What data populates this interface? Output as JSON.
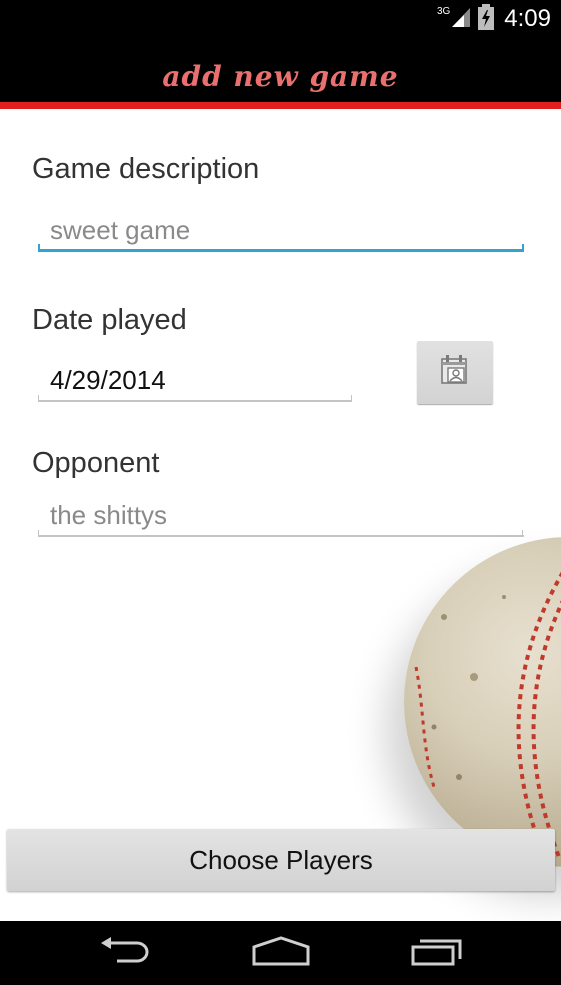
{
  "status_bar": {
    "network": "3G",
    "time": "4:09"
  },
  "action_bar": {
    "title": "add new game"
  },
  "form": {
    "description": {
      "label": "Game description",
      "placeholder": "sweet game"
    },
    "date": {
      "label": "Date played",
      "value": "4/29/2014"
    },
    "opponent": {
      "label": "Opponent",
      "placeholder": "the shittys"
    }
  },
  "choose_players_label": "Choose Players",
  "colors": {
    "accent_line": "#e31e1e",
    "title": "#e9706f",
    "focus": "#33a2cc"
  },
  "icons": {
    "signal": "signal-icon",
    "battery": "battery-icon",
    "calendar": "calendar-icon",
    "back": "back-icon",
    "home": "home-icon",
    "recents": "recents-icon"
  }
}
